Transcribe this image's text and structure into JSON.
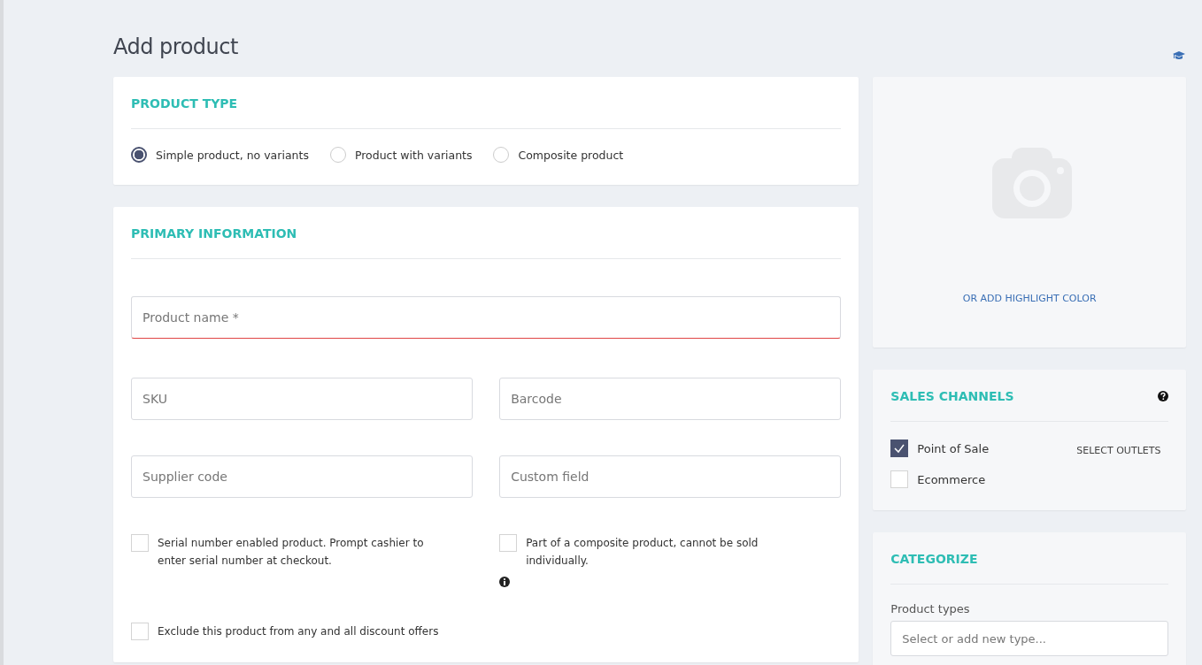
{
  "page": {
    "title": "Add product"
  },
  "product_type": {
    "heading": "PRODUCT TYPE",
    "options": [
      {
        "label": "Simple product, no variants",
        "selected": true
      },
      {
        "label": "Product with variants",
        "selected": false
      },
      {
        "label": "Composite product",
        "selected": false
      }
    ]
  },
  "primary_information": {
    "heading": "PRIMARY INFORMATION",
    "name_field": {
      "placeholder": "Product name *",
      "invalid": true
    },
    "fields": [
      {
        "placeholder": "SKU"
      },
      {
        "placeholder": "Barcode"
      },
      {
        "placeholder": "Supplier code"
      },
      {
        "placeholder": "Custom field"
      }
    ],
    "options": [
      {
        "label": "Serial number enabled product. Prompt cashier to enter serial number at checkout.",
        "checked": false,
        "info": false
      },
      {
        "label": "Part of a composite product, cannot be sold individually.",
        "checked": false,
        "info": true
      },
      {
        "label": "Exclude this product from any and all discount offers",
        "checked": false,
        "info": false
      }
    ]
  },
  "image": {
    "link": "OR ADD HIGHLIGHT COLOR"
  },
  "sales_channels": {
    "heading": "SALES CHANNELS",
    "channels": [
      {
        "label": "Point of Sale",
        "checked": true,
        "action": "SELECT OUTLETS"
      },
      {
        "label": "Ecommerce",
        "checked": false
      }
    ]
  },
  "categorize": {
    "heading": "CATEGORIZE",
    "product_types": {
      "label": "Product types",
      "placeholder": "Select or add new type..."
    }
  }
}
